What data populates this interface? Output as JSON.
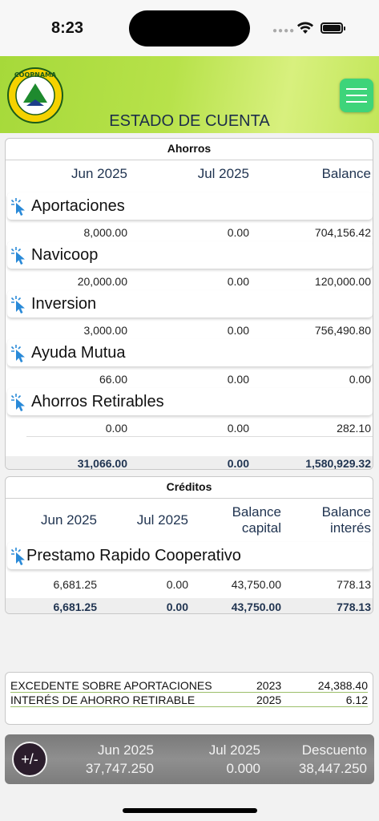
{
  "status_bar": {
    "time": "8:23"
  },
  "header": {
    "title": "ESTADO DE CUENTA",
    "logo_text": "COOPNAMA"
  },
  "ahorros": {
    "title": "Ahorros",
    "columns": [
      "Jun 2025",
      "Jul 2025",
      "Balance"
    ],
    "accounts": [
      {
        "name": "Aportaciones",
        "jun": "8,000.00",
        "jul": "0.00",
        "balance": "704,156.42"
      },
      {
        "name": "Navicoop",
        "jun": "20,000.00",
        "jul": "0.00",
        "balance": "120,000.00"
      },
      {
        "name": "Inversion",
        "jun": "3,000.00",
        "jul": "0.00",
        "balance": "756,490.80"
      },
      {
        "name": "Ayuda Mutua",
        "jun": "66.00",
        "jul": "0.00",
        "balance": "0.00"
      },
      {
        "name": "Ahorros Retirables",
        "jun": "0.00",
        "jul": "0.00",
        "balance": "282.10"
      }
    ],
    "totals": {
      "jun": "31,066.00",
      "jul": "0.00",
      "balance": "1,580,929.32"
    }
  },
  "creditos": {
    "title": "Créditos",
    "columns": [
      "Jun 2025",
      "Jul 2025",
      "Balance\ncapital",
      "Balance\ninterés"
    ],
    "accounts": [
      {
        "name": "Prestamo Rapido Cooperativo",
        "jun": "6,681.25",
        "jul": "0.00",
        "capital": "43,750.00",
        "interes": "778.13"
      }
    ],
    "totals": {
      "jun": "6,681.25",
      "jul": "0.00",
      "capital": "43,750.00",
      "interes": "778.13"
    }
  },
  "excedentes": [
    {
      "label": "EXCEDENTE SOBRE APORTACIONES",
      "year": "2023",
      "amount": "24,388.40"
    },
    {
      "label": "INTERÉS DE AHORRO RETIRABLE",
      "year": "2025",
      "amount": "6.12"
    }
  ],
  "footer": {
    "button_label": "+/-",
    "columns": [
      {
        "label": "Jun 2025",
        "value": "37,747.250"
      },
      {
        "label": "Jul 2025",
        "value": "0.000"
      },
      {
        "label": "Descuento",
        "value": "38,447.250"
      }
    ]
  },
  "colors": {
    "header_green": "#b7e24a",
    "menu_green": "#3ed47a",
    "label_navy": "#1f3350"
  }
}
